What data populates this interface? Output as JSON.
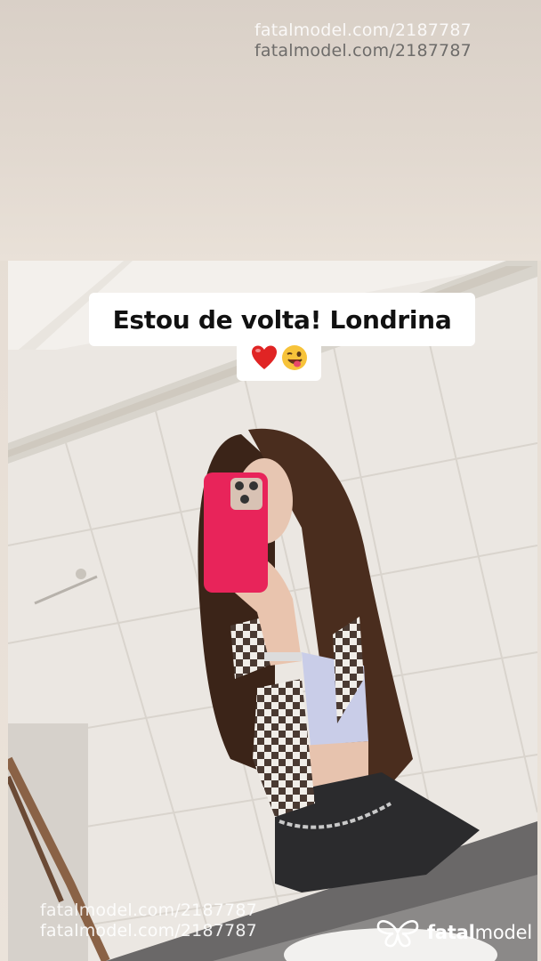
{
  "watermarks": {
    "top_line1": "fatalmodel.com/2187787",
    "top_line2": "fatalmodel.com/2187787",
    "bottom_line1": "fatalmodel.com/2187787",
    "bottom_line2": "fatalmodel.com/2187787"
  },
  "story": {
    "caption_text": "Estou de volta! Londrina",
    "caption_emojis": [
      "red-heart-emoji",
      "winking-face-tongue-emoji"
    ]
  },
  "brand": {
    "name_part1": "fatal",
    "name_part2": "model",
    "logo_icon": "butterfly-logo-icon"
  },
  "colors": {
    "phone_case": "#e8245a",
    "caption_bg": "#ffffff",
    "caption_text": "#111111",
    "heart": "#e02424",
    "emoji_face": "#f7c33a"
  }
}
